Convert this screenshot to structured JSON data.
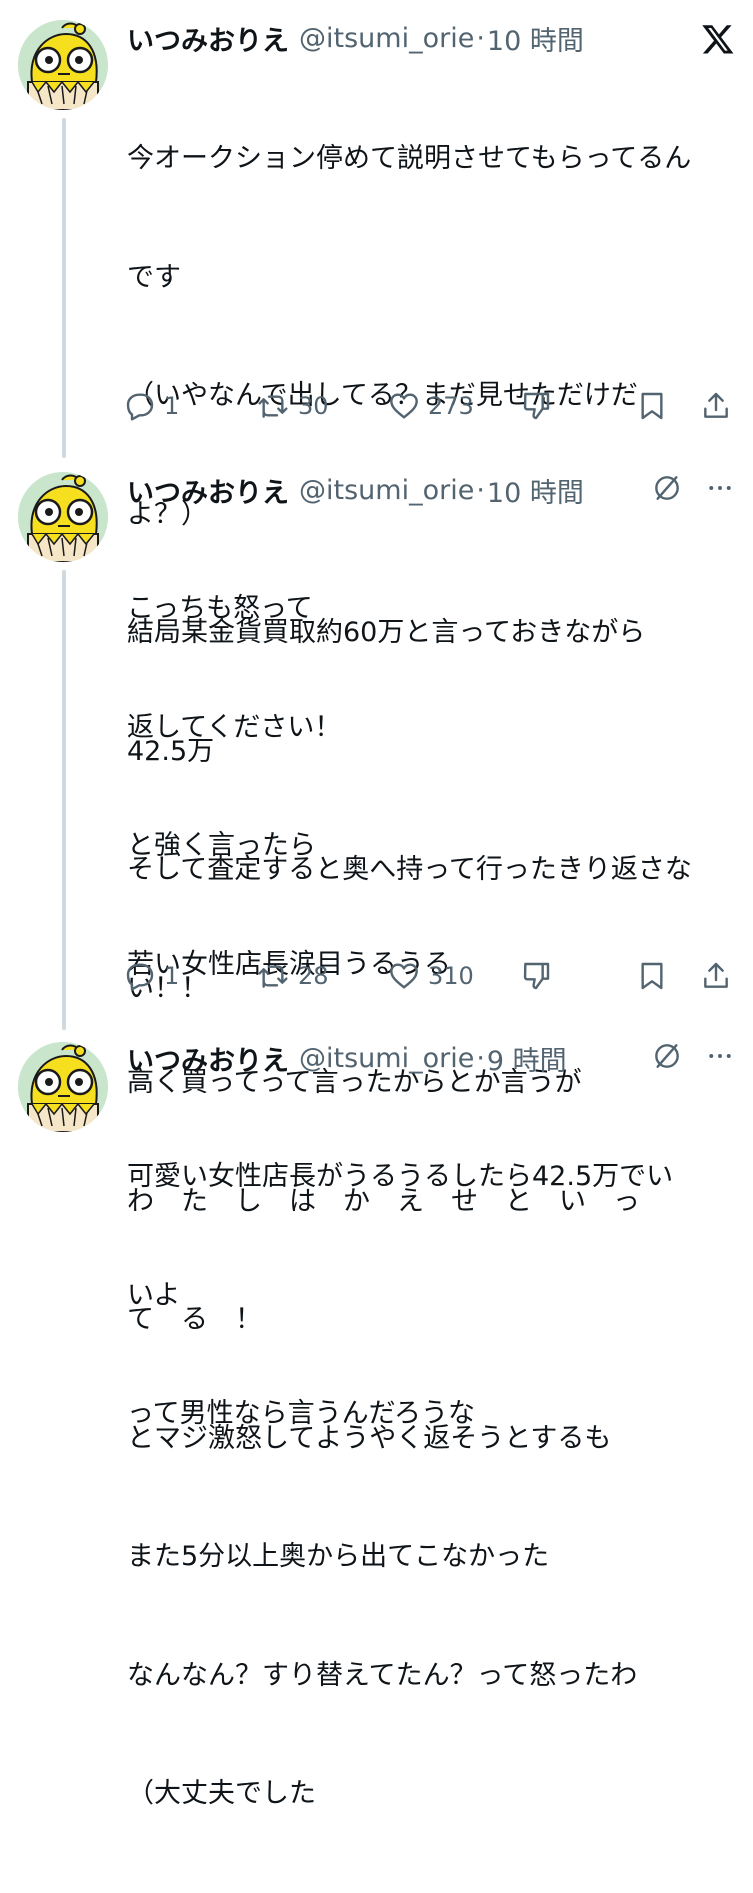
{
  "tweets": [
    {
      "name": "いつみおりえ",
      "handle": "@itsumi_orie",
      "time": "10 時間",
      "lines": [
        "今オークション停めて説明させてもらってるん",
        "です",
        "（いやなんで出してる？まだ見せただけだ",
        "よ？）",
        "結局某金貨買取約60万と言っておきながら",
        "42.5万",
        "そして査定すると奥へ持って行ったきり返さな",
        "い！！"
      ],
      "replies": "1",
      "reposts": "30",
      "likes": "273"
    },
    {
      "name": "いつみおりえ",
      "handle": "@itsumi_orie",
      "time": "10 時間",
      "lines": [
        "こっちも怒って",
        "返してください！",
        "と強く言ったら",
        "若い女性店長涙目うるうる",
        "高く買ってって言ったからとか言うが",
        "わ　た　し　は　か　え　せ　と　い　っ",
        "て　る　！",
        "とマジ激怒してようやく返そうとするも",
        "また5分以上奥から出てこなかった",
        "なんなん？すり替えてたん？って怒ったわ",
        "（大丈夫でした"
      ],
      "replies": "1",
      "reposts": "28",
      "likes": "310"
    },
    {
      "name": "いつみおりえ",
      "handle": "@itsumi_orie",
      "time": "9 時間",
      "lines": [
        "可愛い女性店長がうるうるしたら42.5万でい",
        "いよ",
        "って男性なら言うんだろうな"
      ]
    }
  ],
  "icons": {
    "brand": "x-logo-icon",
    "reply": "reply-icon",
    "repost": "repost-icon",
    "like": "heart-icon",
    "dislike": "dislike-icon",
    "bookmark": "bookmark-icon",
    "share": "share-icon",
    "grok": "grok-icon",
    "more": "more-icon"
  },
  "colors": {
    "text": "#0f1419",
    "secondary": "#536471",
    "thread_line": "#cfd9de",
    "avatar_bg": "#c9e6cd",
    "avatar_character": "#f5df1e"
  }
}
